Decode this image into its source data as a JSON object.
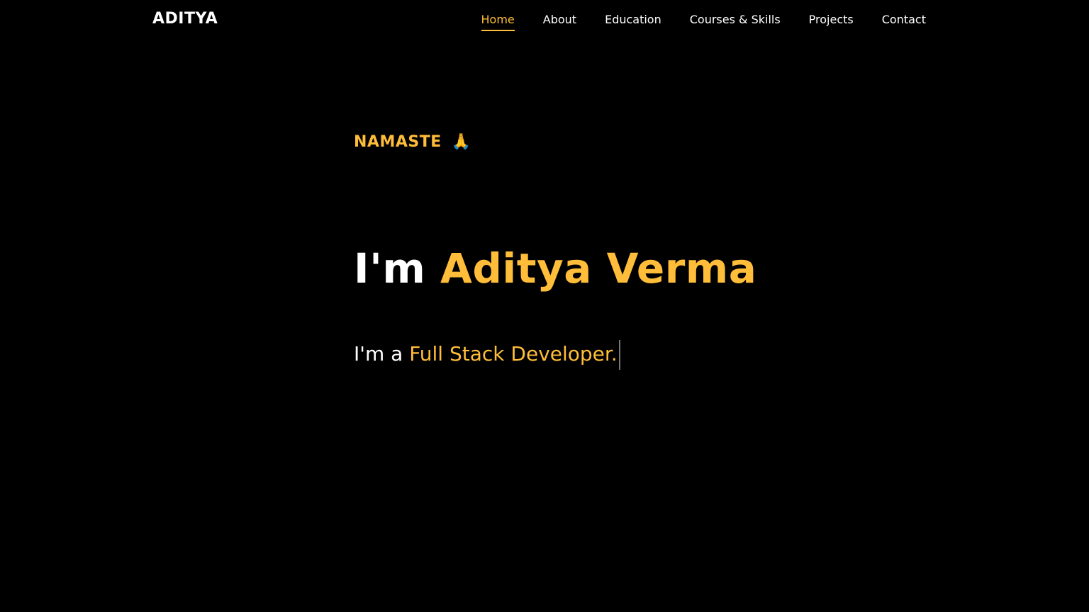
{
  "brand": {
    "name": "ADITYA"
  },
  "nav": {
    "items": [
      {
        "label": "Home",
        "active": true
      },
      {
        "label": "About",
        "active": false
      },
      {
        "label": "Education",
        "active": false
      },
      {
        "label": "Courses & Skills",
        "active": false
      },
      {
        "label": "Projects",
        "active": false
      },
      {
        "label": "Contact",
        "active": false
      }
    ]
  },
  "hero": {
    "greeting": "NAMASTE",
    "greeting_emoji": "🙏",
    "name_prefix": "I'm",
    "name": "Aditya Verma",
    "tagline_prefix": "I'm a",
    "tagline_role": "Full Stack Developer."
  },
  "colors": {
    "background": "#000000",
    "accent": "#ffbd39",
    "text": "#ffffff"
  }
}
